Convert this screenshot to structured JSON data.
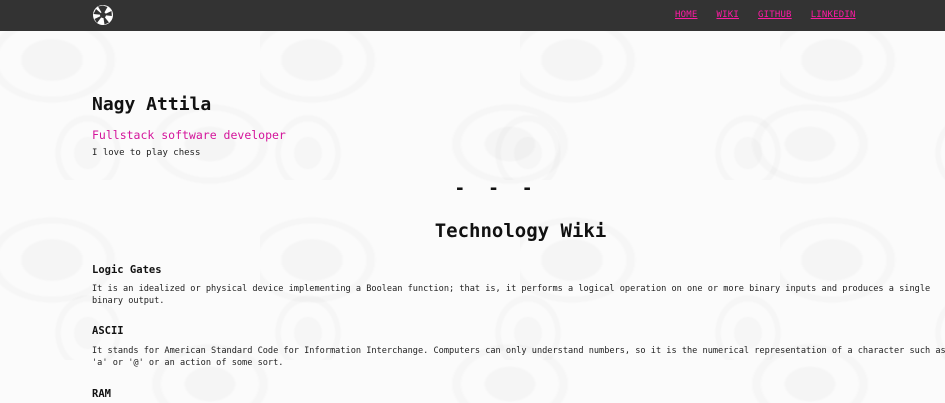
{
  "nav": {
    "logo_icon": "aperture-icon",
    "links": [
      "HOME",
      "WIKI",
      "GITHUB",
      "LINKEDIN"
    ],
    "link_color": "#ff1aa3"
  },
  "profile": {
    "name": "Nagy Attila",
    "subtitle": "Fullstack software developer",
    "tagline": "I love to play chess"
  },
  "separator": "- - -",
  "wiki": {
    "title": "Technology Wiki",
    "entries": [
      {
        "title": "Logic Gates",
        "body": "It is an idealized or physical device implementing a Boolean function; that is, it performs a logical operation on one or more binary inputs and produces a single binary output."
      },
      {
        "title": "ASCII",
        "body": "It stands for American Standard Code for Information Interchange. Computers can only understand numbers, so it is the numerical representation of a character such as 'a' or '@' or an action of some sort."
      },
      {
        "title": "RAM",
        "body": ""
      }
    ]
  },
  "colors": {
    "topbar": "#333333",
    "accent": "#d4149b"
  }
}
